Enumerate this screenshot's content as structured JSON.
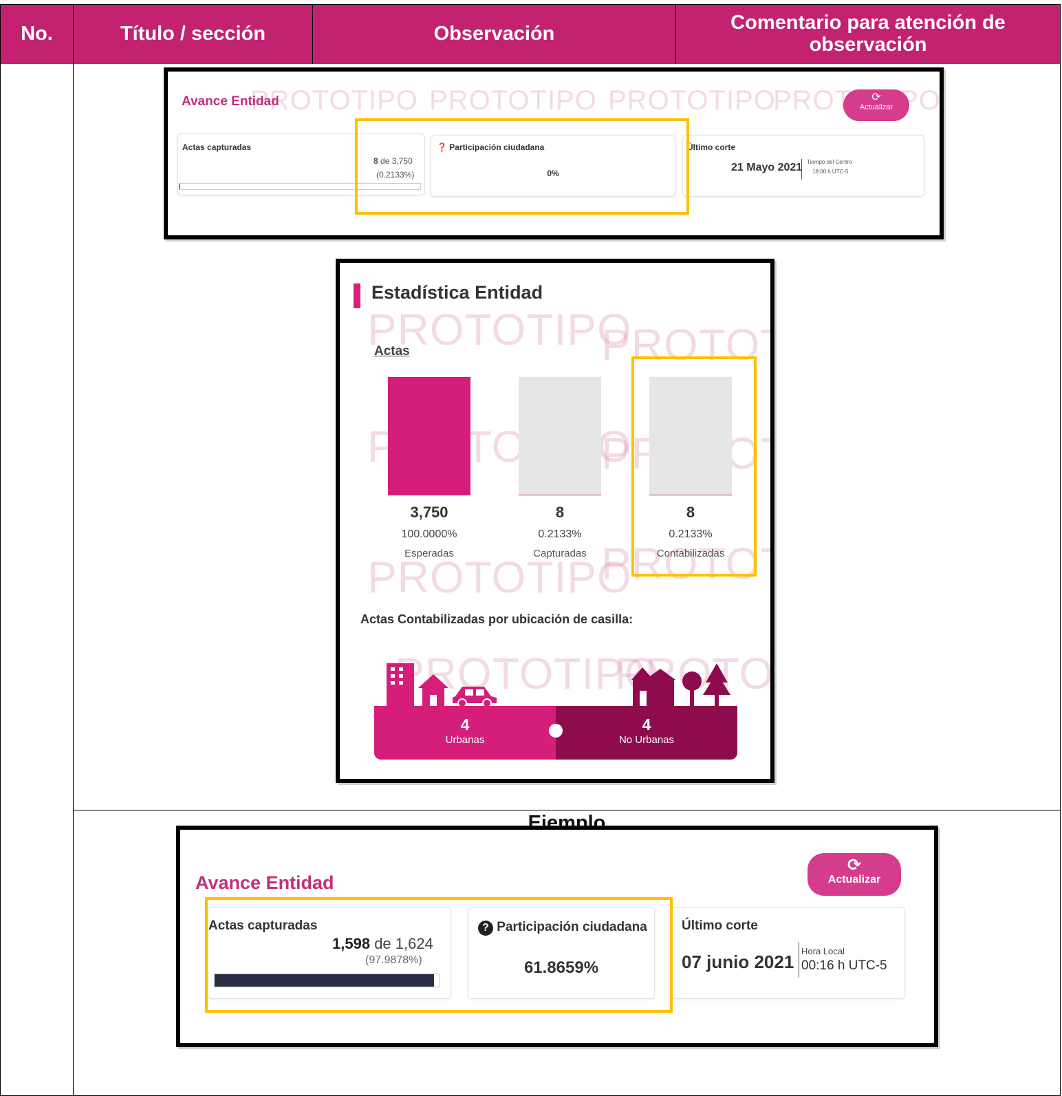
{
  "table": {
    "headers": [
      "No.",
      "Título / sección",
      "Observación",
      "Comentario para atención de observación"
    ],
    "example_label": "Ejemplo"
  },
  "colors": {
    "header_bg": "#C32270",
    "accent_pink": "#D51D7A",
    "dark_magenta": "#8E0B4E",
    "highlight": "#FFC000",
    "progress_bar": "#2C2E46"
  },
  "shot1": {
    "title": "Avance Entidad",
    "refresh_icon": "refresh-icon",
    "refresh_label": "Actualizar",
    "actas_label": "Actas capturadas",
    "actas_value": "8",
    "actas_of": "de 3,750",
    "actas_pct": "(0.2133%)",
    "participacion_label": "Participación ciudadana",
    "participacion_value": "0%",
    "corte_label": "Último corte",
    "corte_date": "21 Mayo 2021",
    "corte_zone": "Tiempo del Centro",
    "corte_time": "18:00 h UTC-5",
    "watermark": "PROTOTIPO",
    "progress": 0.002133
  },
  "shot2": {
    "title": "Estadística Entidad",
    "subtitle": "Actas",
    "watermark": "PROTOTIPO",
    "bars": [
      {
        "value": "3,750",
        "pct": "100.0000%",
        "label": "Esperadas",
        "fill": 1.0
      },
      {
        "value": "8",
        "pct": "0.2133%",
        "label": "Capturadas",
        "fill": 0.002133
      },
      {
        "value": "8",
        "pct": "0.2133%",
        "label": "Contabilizadas",
        "fill": 0.002133
      }
    ],
    "location_title": "Actas Contabilizadas por ubicación de casilla:",
    "urbanas": {
      "count": "4",
      "label": "Urbanas"
    },
    "no_urbanas": {
      "count": "4",
      "label": "No Urbanas"
    }
  },
  "shot3": {
    "title": "Avance Entidad",
    "refresh_icon": "refresh-icon",
    "refresh_label": "Actualizar",
    "actas_label": "Actas capturadas",
    "actas_value": "1,598",
    "actas_of": "de 1,624",
    "actas_pct": "(97.9878%)",
    "participacion_label": "Participación ciudadana",
    "participacion_value": "61.8659%",
    "corte_label": "Último corte",
    "corte_date": "07 junio 2021",
    "corte_zone": "Hora Local",
    "corte_time": "00:16 h UTC-5",
    "progress": 0.979878
  }
}
